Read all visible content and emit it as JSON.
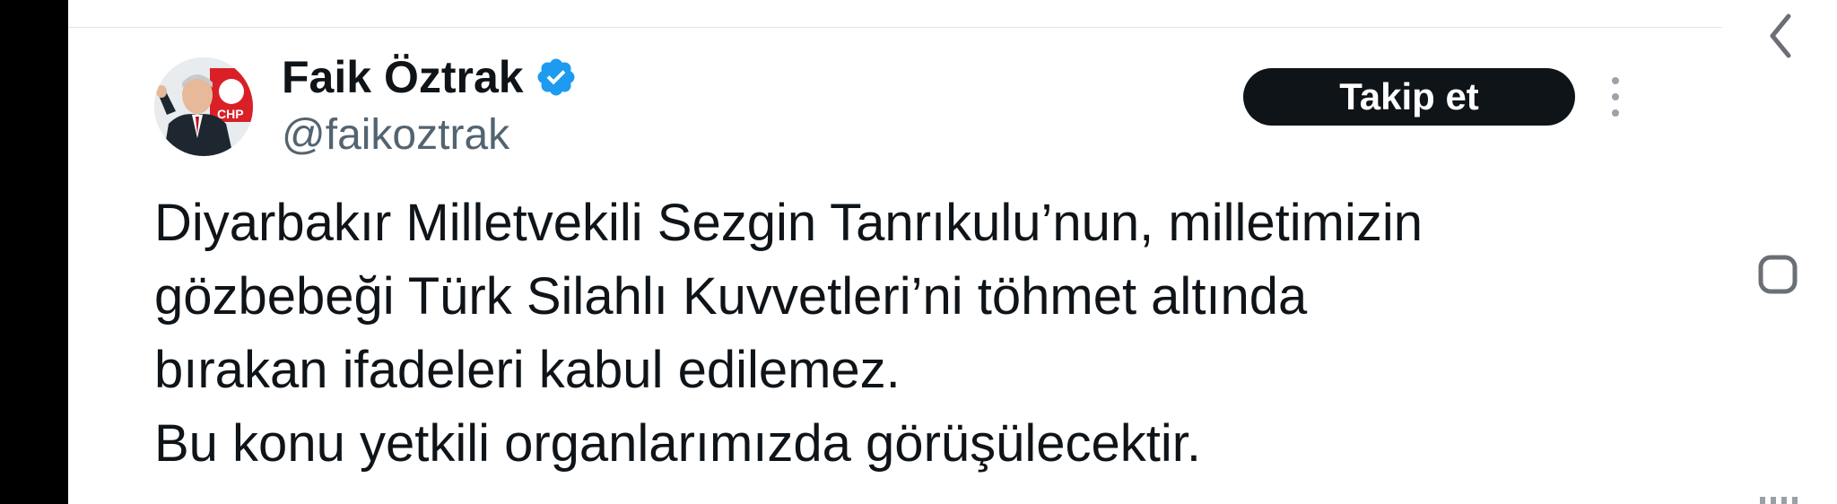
{
  "tweet": {
    "author_name": "Faik Öztrak",
    "handle": "@faikoztrak",
    "verified": true,
    "follow_label": "Takip et",
    "avatar_badge": "CHP",
    "text_lines": [
      "Diyarbakır Milletvekili Sezgin Tanrıkulu’nun, milletimizin",
      "gözbebeği Türk Silahlı Kuvvetleri’ni töhmet altında",
      "bırakan ifadeleri kabul edilemez.",
      "Bu konu yetkili organlarımızda görüşülecektir."
    ]
  },
  "icons": {
    "verified": "verified-badge-icon",
    "more": "more-vertical-icon",
    "back": "chevron-left-icon",
    "recent": "recent-apps-icon"
  },
  "colors": {
    "verified_blue": "#1d9bf0",
    "follow_bg": "#0f1419",
    "text": "#0f1419",
    "handle": "#536471"
  }
}
